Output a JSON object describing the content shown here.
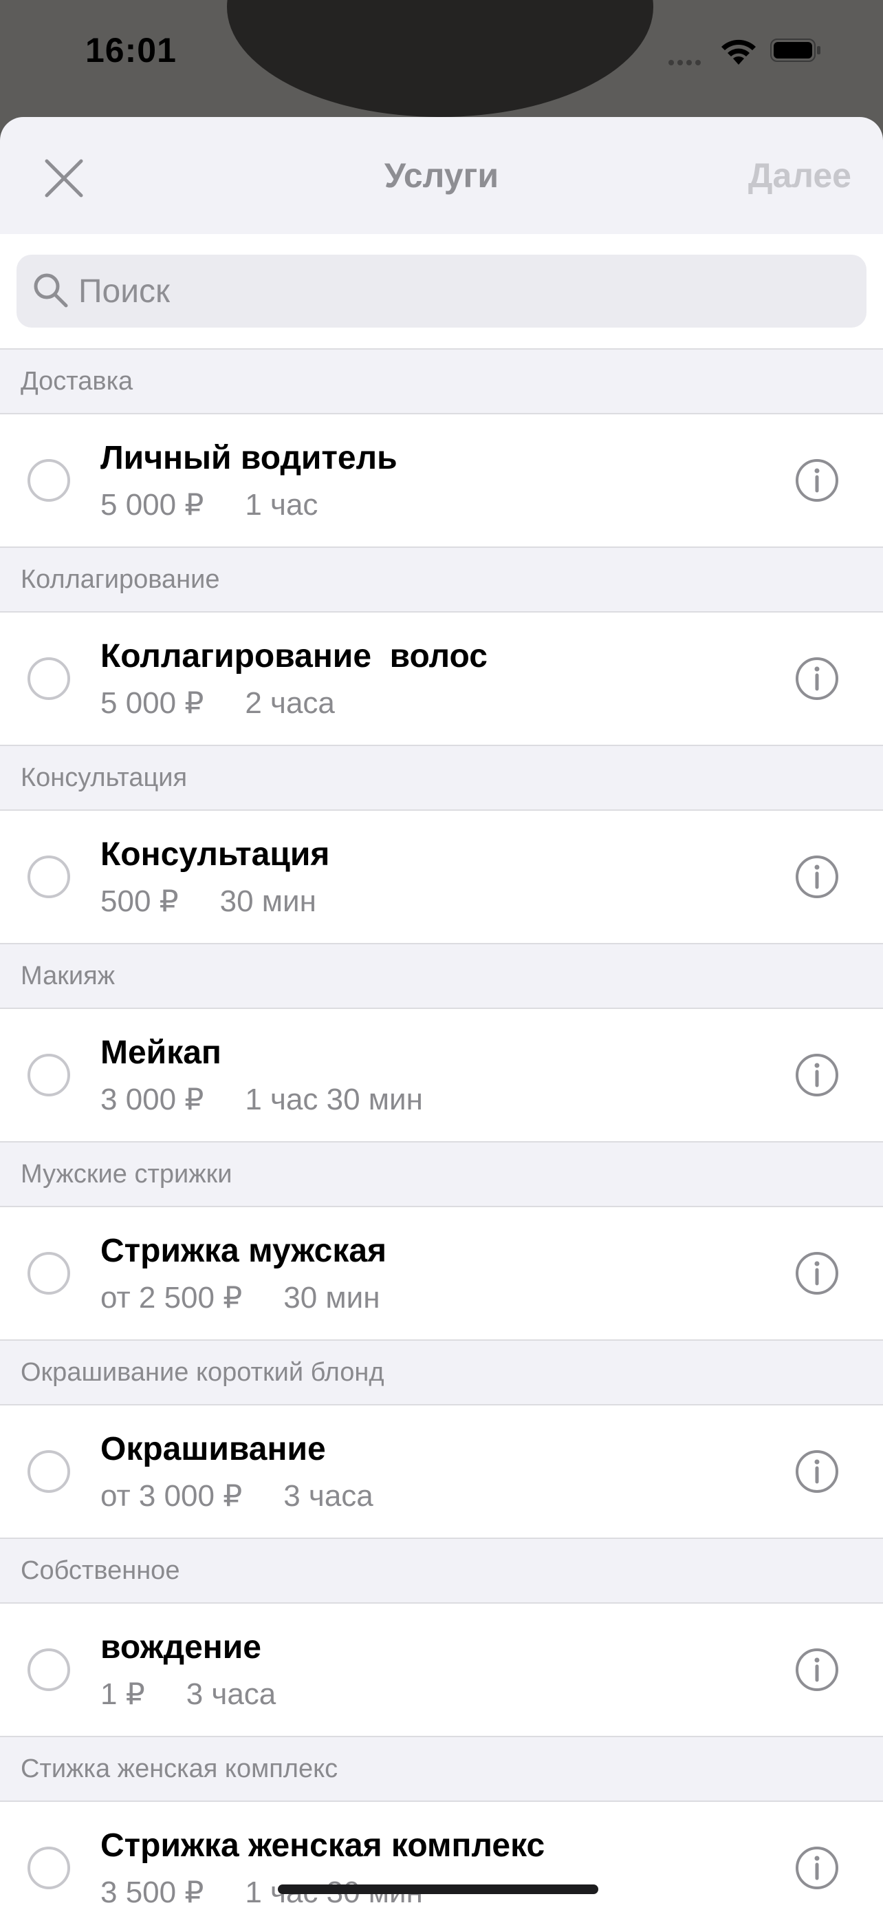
{
  "status_bar": {
    "time": "16:01"
  },
  "nav": {
    "title": "Услуги",
    "next_label": "Далее"
  },
  "search": {
    "placeholder": "Поиск"
  },
  "sections": [
    {
      "header": "Доставка",
      "item": {
        "title": "Личный водитель",
        "price": "5 000 ₽",
        "duration": "1 час"
      }
    },
    {
      "header": "Коллагирование",
      "item": {
        "title": "Коллагирование  волос",
        "price": "5 000 ₽",
        "duration": "2 часа"
      }
    },
    {
      "header": "Консультация",
      "item": {
        "title": "Консультация",
        "price": "500 ₽",
        "duration": "30 мин"
      }
    },
    {
      "header": "Макияж",
      "item": {
        "title": "Мейкап",
        "price": "3 000 ₽",
        "duration": "1 час 30 мин"
      }
    },
    {
      "header": "Мужские стрижки",
      "item": {
        "title": "Стрижка мужская",
        "price": "от 2 500 ₽",
        "duration": "30 мин"
      }
    },
    {
      "header": "Окрашивание короткий блонд",
      "item": {
        "title": "Окрашивание",
        "price": "от 3 000 ₽",
        "duration": "3 часа"
      }
    },
    {
      "header": "Собственное",
      "item": {
        "title": "вождение",
        "price": "1 ₽",
        "duration": "3 часа"
      }
    },
    {
      "header": "Стижка женская комплекс",
      "item": {
        "title": "Стрижка женская комплекс",
        "price": "3 500 ₽",
        "duration": "1 час 30 мин"
      }
    }
  ],
  "icons": {
    "close": "close-icon",
    "search": "search-icon",
    "radio": "radio-unchecked-icon",
    "info": "info-icon"
  },
  "colors": {
    "sheet_bg": "#f2f2f7",
    "secondary_text": "#8a8a8e",
    "disabled_action": "#c7c7cc"
  }
}
